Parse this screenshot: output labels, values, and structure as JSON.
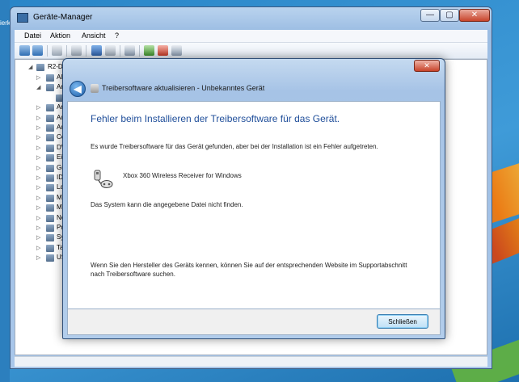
{
  "desktop": {
    "icon_label": "ierk"
  },
  "device_manager": {
    "title": "Geräte-Manager",
    "window_buttons": {
      "minimize": "—",
      "maximize": "▢",
      "close": "✕"
    },
    "menu": [
      "Datei",
      "Aktion",
      "Ansicht",
      "?"
    ],
    "tree": {
      "root": "R2-D2",
      "items": [
        {
          "label": "Al",
          "icon": "audio-icon",
          "expander": "▷"
        },
        {
          "label": "Ar",
          "icon": "other-devices-icon",
          "expander": "◢"
        },
        {
          "label": "",
          "icon": "unknown-device-icon",
          "expander": ""
        },
        {
          "label": "Ar",
          "icon": "computer-icon",
          "expander": "▷"
        },
        {
          "label": "Au",
          "icon": "speaker-icon",
          "expander": "▷"
        },
        {
          "label": "Au",
          "icon": "speaker-icon",
          "expander": "▷"
        },
        {
          "label": "Co",
          "icon": "monitor-icon",
          "expander": "▷"
        },
        {
          "label": "DV",
          "icon": "disc-icon",
          "expander": "▷"
        },
        {
          "label": "Ei",
          "icon": "keyboard-icon",
          "expander": "▷"
        },
        {
          "label": "Gr",
          "icon": "display-adapter-icon",
          "expander": "▷"
        },
        {
          "label": "ID",
          "icon": "ide-controller-icon",
          "expander": "▷"
        },
        {
          "label": "La",
          "icon": "drive-icon",
          "expander": "▷"
        },
        {
          "label": "M",
          "icon": "mouse-icon",
          "expander": "▷"
        },
        {
          "label": "M",
          "icon": "monitor-icon",
          "expander": "▷"
        },
        {
          "label": "Ne",
          "icon": "network-icon",
          "expander": "▷"
        },
        {
          "label": "Pr",
          "icon": "processor-icon",
          "expander": "▷"
        },
        {
          "label": "Sy",
          "icon": "system-icon",
          "expander": "▷"
        },
        {
          "label": "Ta",
          "icon": "keyboard-icon",
          "expander": "▷"
        },
        {
          "label": "US",
          "icon": "usb-icon",
          "expander": "▷"
        }
      ]
    }
  },
  "dialog": {
    "close_glyph": "✕",
    "back_glyph": "◀",
    "title": "Treibersoftware aktualisieren - Unbekanntes Gerät",
    "heading": "Fehler beim Installieren der Treibersoftware für das Gerät.",
    "found_text": "Es wurde Treibersoftware für das Gerät gefunden, aber bei der Installation ist ein Fehler aufgetreten.",
    "device_name": "Xbox 360 Wireless Receiver for Windows",
    "system_message": "Das System kann die angegebene Datei nicht finden.",
    "support_text": "Wenn Sie den Hersteller des Geräts kennen, können Sie auf der entsprechenden Website im Supportabschnitt nach Treibersoftware suchen.",
    "close_button": "Schließen"
  },
  "colors": {
    "heading_blue": "#1f4e9a",
    "close_red": "#c7432a"
  }
}
